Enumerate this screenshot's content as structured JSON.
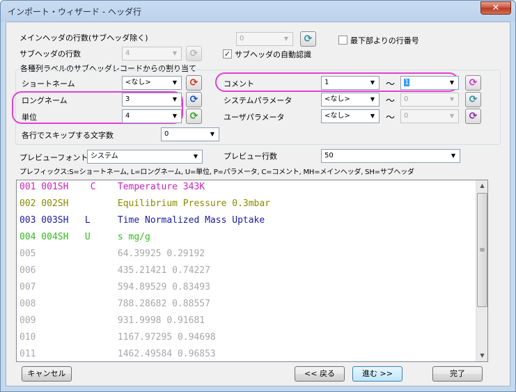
{
  "window": {
    "title": "インポート・ウィザード - ヘッダ行",
    "close_label": "✕"
  },
  "header": {
    "main_header_label": "メインヘッダの行数(サブヘッダ除く)",
    "main_header_value": "0",
    "sub_header_label": "サブヘッダの行数",
    "sub_header_value": "4",
    "bottom_line_label": "最下部よりの行番号",
    "bottom_line_checked": false,
    "auto_detect_label": "サブヘッダの自動認識",
    "auto_detect_checked": true
  },
  "assign": {
    "group_label": "各種列ラベルのサブヘッダレコードからの割り当て",
    "short_name_label": "ショートネーム",
    "short_name_value": "<なし>",
    "long_name_label": "ロングネーム",
    "long_name_value": "3",
    "units_label": "単位",
    "units_value": "4",
    "comment_label": "コメント",
    "comment_from": "1",
    "comment_to": "1",
    "sysparam_label": "システムパラメータ",
    "sysparam_from": "<なし>",
    "sysparam_to": "0",
    "userparam_label": "ユーザパラメータ",
    "userparam_from": "<なし>",
    "userparam_to": "0",
    "tilde": "〜"
  },
  "skip": {
    "label": "各行でスキップする文字数",
    "value": "0"
  },
  "preview": {
    "font_label": "プレビューフォント",
    "font_value": "システム",
    "lines_label": "プレビュー行数",
    "lines_value": "50",
    "prefix_text": "プレフィックス:S=ショートネーム, L=ロングネーム, U=単位, P=パラメータ, C=コメント, MH=メインヘッダ, SH=サブヘッダ",
    "rows": [
      {
        "text": "001 001SH    C    Temperature 343K",
        "color": "#cc22bb"
      },
      {
        "text": "002 002SH         Equilibrium Pressure 0.3mbar",
        "color": "#8a8a00"
      },
      {
        "text": "003 003SH   L     Time Normalized Mass Uptake",
        "color": "#1a1aa6"
      },
      {
        "text": "004 004SH   U     s mg/g",
        "color": "#33bb22"
      },
      {
        "text": "005               64.39925 0.29192",
        "color": "#a8a8a8"
      },
      {
        "text": "006               435.21421 0.74227",
        "color": "#a8a8a8"
      },
      {
        "text": "007               594.89529 0.83493",
        "color": "#a8a8a8"
      },
      {
        "text": "008               788.28682 0.88557",
        "color": "#a8a8a8"
      },
      {
        "text": "009               931.9998 0.91681",
        "color": "#a8a8a8"
      },
      {
        "text": "010               1167.97295 0.94698",
        "color": "#a8a8a8"
      },
      {
        "text": "011               1462.49584 0.96853",
        "color": "#a8a8a8"
      }
    ]
  },
  "footer": {
    "cancel_label": "キャンセル",
    "back_label": "<< 戻る",
    "next_label": "進む >>",
    "finish_label": "完了"
  },
  "icons": {
    "refresh": "⟳",
    "check": "✓",
    "arrow_down": "▼",
    "arrow_up": "▲",
    "grip": "≡"
  },
  "colors": {
    "highlight": "#e23fd6"
  }
}
